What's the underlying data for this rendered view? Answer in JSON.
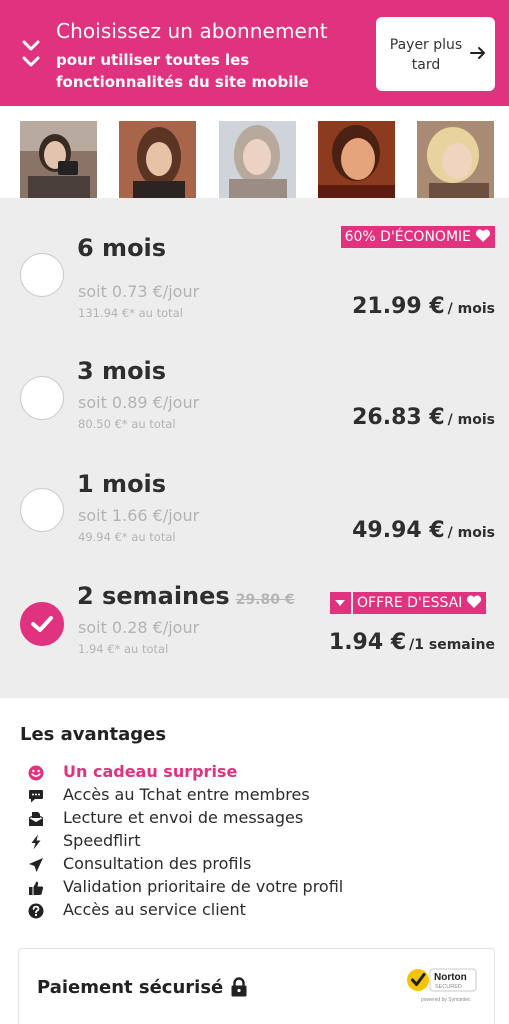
{
  "header": {
    "title": "Choisissez un abonnement",
    "subtitle": "pour utiliser toutes les fonctionnalités du site mobile",
    "pay_later_label": "Payer plus tard",
    "accent_color": "#e0327f"
  },
  "plans": [
    {
      "name": "6 mois",
      "per_day": "soit 0.73 €/jour",
      "total": "131.94 €* au total",
      "price": "21.99 €",
      "unit": "/ mois",
      "badge": "60% D'ÉCONOMIE",
      "selected": false
    },
    {
      "name": "3 mois",
      "per_day": "soit 0.89 €/jour",
      "total": "80.50 €* au total",
      "price": "26.83 €",
      "unit": "/ mois",
      "selected": false
    },
    {
      "name": "1 mois",
      "per_day": "soit 1.66 €/jour",
      "total": "49.94 €* au total",
      "price": "49.94 €",
      "unit": "/ mois",
      "selected": false
    },
    {
      "name": "2 semaines",
      "old_price": "29.80 €",
      "per_day": "soit 0.28 €/jour",
      "total": "1.94 €* au total",
      "price": "1.94 €",
      "unit": "/1 semaine",
      "badge": "OFFRE D'ESSAI",
      "selected": true
    }
  ],
  "advantages": {
    "title": "Les avantages",
    "items": [
      {
        "label": "Un cadeau surprise",
        "icon": "smiley-icon"
      },
      {
        "label": "Accès au Tchat entre membres",
        "icon": "chat-icon"
      },
      {
        "label": "Lecture et envoi de messages",
        "icon": "mail-icon"
      },
      {
        "label": "Speedflirt",
        "icon": "lightning-icon"
      },
      {
        "label": "Consultation des profils",
        "icon": "send-icon"
      },
      {
        "label": "Validation prioritaire de votre profil",
        "icon": "thumbs-up-icon"
      },
      {
        "label": "Accès au service client",
        "icon": "help-icon"
      }
    ]
  },
  "secure": {
    "label": "Paiement sécurisé"
  }
}
